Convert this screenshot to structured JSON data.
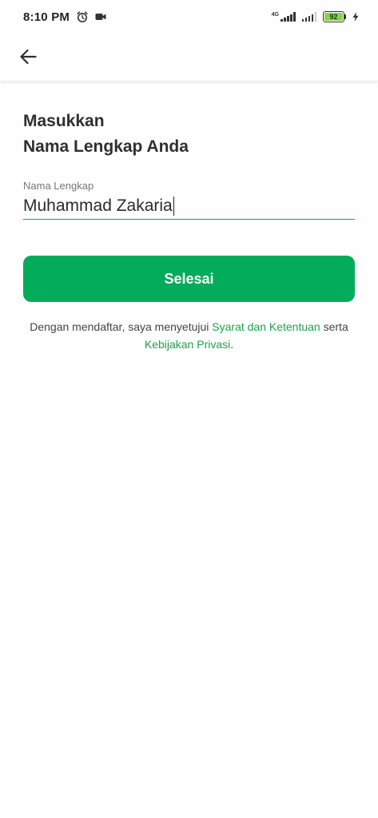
{
  "status_bar": {
    "time": "8:10 PM",
    "network_type": "4G",
    "battery_level": "92"
  },
  "app_bar": {
    "back_icon": "arrow-left-icon"
  },
  "form": {
    "heading_line1": "Masukkan",
    "heading_line2": "Nama Lengkap Anda",
    "full_name_label": "Nama Lengkap",
    "full_name_value": "Muhammad Zakaria",
    "submit_label": "Selesai"
  },
  "terms": {
    "prefix": "Dengan mendaftar, saya menyetujui ",
    "terms_link": "Syarat dan Ketentuan",
    "middle": " serta",
    "privacy_link": "Kebijakan Privasi",
    "suffix": "."
  },
  "colors": {
    "accent": "#03ac5a",
    "link": "#1ea34d",
    "battery_fill": "#8fd14f"
  }
}
